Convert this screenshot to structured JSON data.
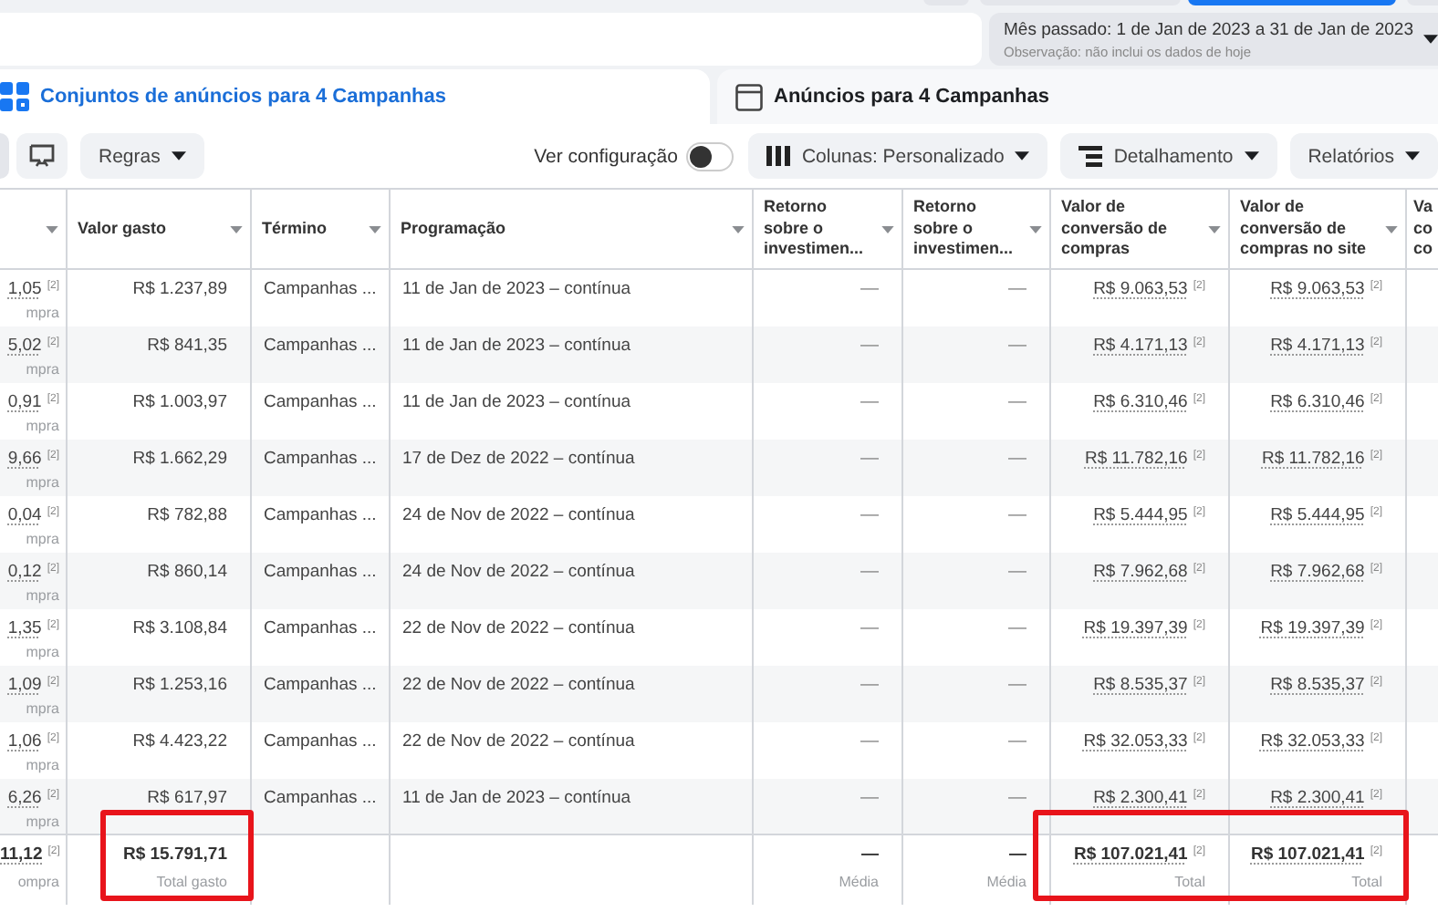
{
  "date_range": {
    "label": "Mês passado: 1 de Jan de 2023 a 31 de Jan de 2023",
    "note": "Observação: não inclui os dados de hoje"
  },
  "tabs": [
    {
      "label": "Conjuntos de anúncios para 4 Campanhas",
      "kind": "adsets",
      "selected": true
    },
    {
      "label": "Anúncios para 4 Campanhas",
      "kind": "ads",
      "selected": false
    }
  ],
  "toolbar": {
    "rules": "Regras",
    "toggle": {
      "label": "Ver configuração",
      "on": false
    },
    "columns": "Colunas: Personalizado",
    "breakdown": "Detalhamento",
    "reports": "Relatórios"
  },
  "table": {
    "columns": [
      {
        "kind": "cut"
      },
      {
        "label": "Valor gasto"
      },
      {
        "label": "Término"
      },
      {
        "label": "Programação"
      },
      {
        "label": "Retorno sobre o investimen..."
      },
      {
        "label": "Retorno sobre o investimen..."
      },
      {
        "label": "Valor de conversão de compras"
      },
      {
        "label": "Valor de conversão de compras no site"
      },
      {
        "label": "Va co co"
      }
    ],
    "rows": [
      {
        "cells": [
          {
            "kind": "metric",
            "value": "1,05",
            "note": "[2]",
            "sub": "mpra"
          },
          {
            "kind": "plain",
            "value": "R$ 1.237,89"
          },
          {
            "kind": "plain",
            "value": "Campanhas ..."
          },
          {
            "kind": "plain",
            "value": "11 de Jan de 2023 – contínua"
          },
          {
            "kind": "dash",
            "value": "—"
          },
          {
            "kind": "dash",
            "value": "—"
          },
          {
            "kind": "metric",
            "value": "R$ 9.063,53",
            "note": "[2]"
          },
          {
            "kind": "metric",
            "value": "R$ 9.063,53",
            "note": "[2]"
          }
        ]
      },
      {
        "cells": [
          {
            "kind": "metric",
            "value": "5,02",
            "note": "[2]",
            "sub": "mpra"
          },
          {
            "kind": "plain",
            "value": "R$ 841,35"
          },
          {
            "kind": "plain",
            "value": "Campanhas ..."
          },
          {
            "kind": "plain",
            "value": "11 de Jan de 2023 – contínua"
          },
          {
            "kind": "dash",
            "value": "—"
          },
          {
            "kind": "dash",
            "value": "—"
          },
          {
            "kind": "metric",
            "value": "R$ 4.171,13",
            "note": "[2]"
          },
          {
            "kind": "metric",
            "value": "R$ 4.171,13",
            "note": "[2]"
          }
        ]
      },
      {
        "cells": [
          {
            "kind": "metric",
            "value": "0,91",
            "note": "[2]",
            "sub": "mpra"
          },
          {
            "kind": "plain",
            "value": "R$ 1.003,97"
          },
          {
            "kind": "plain",
            "value": "Campanhas ..."
          },
          {
            "kind": "plain",
            "value": "11 de Jan de 2023 – contínua"
          },
          {
            "kind": "dash",
            "value": "—"
          },
          {
            "kind": "dash",
            "value": "—"
          },
          {
            "kind": "metric",
            "value": "R$ 6.310,46",
            "note": "[2]"
          },
          {
            "kind": "metric",
            "value": "R$ 6.310,46",
            "note": "[2]"
          }
        ]
      },
      {
        "cells": [
          {
            "kind": "metric",
            "value": "9,66",
            "note": "[2]",
            "sub": "mpra"
          },
          {
            "kind": "plain",
            "value": "R$ 1.662,29"
          },
          {
            "kind": "plain",
            "value": "Campanhas ..."
          },
          {
            "kind": "plain",
            "value": "17 de Dez de 2022 – contínua"
          },
          {
            "kind": "dash",
            "value": "—"
          },
          {
            "kind": "dash",
            "value": "—"
          },
          {
            "kind": "metric",
            "value": "R$ 11.782,16",
            "note": "[2]"
          },
          {
            "kind": "metric",
            "value": "R$ 11.782,16",
            "note": "[2]"
          }
        ]
      },
      {
        "cells": [
          {
            "kind": "metric",
            "value": "0,04",
            "note": "[2]",
            "sub": "mpra"
          },
          {
            "kind": "plain",
            "value": "R$ 782,88"
          },
          {
            "kind": "plain",
            "value": "Campanhas ..."
          },
          {
            "kind": "plain",
            "value": "24 de Nov de 2022 – contínua"
          },
          {
            "kind": "dash",
            "value": "—"
          },
          {
            "kind": "dash",
            "value": "—"
          },
          {
            "kind": "metric",
            "value": "R$ 5.444,95",
            "note": "[2]"
          },
          {
            "kind": "metric",
            "value": "R$ 5.444,95",
            "note": "[2]"
          }
        ]
      },
      {
        "cells": [
          {
            "kind": "metric",
            "value": "0,12",
            "note": "[2]",
            "sub": "mpra"
          },
          {
            "kind": "plain",
            "value": "R$ 860,14"
          },
          {
            "kind": "plain",
            "value": "Campanhas ..."
          },
          {
            "kind": "plain",
            "value": "24 de Nov de 2022 – contínua"
          },
          {
            "kind": "dash",
            "value": "—"
          },
          {
            "kind": "dash",
            "value": "—"
          },
          {
            "kind": "metric",
            "value": "R$ 7.962,68",
            "note": "[2]"
          },
          {
            "kind": "metric",
            "value": "R$ 7.962,68",
            "note": "[2]"
          }
        ]
      },
      {
        "cells": [
          {
            "kind": "metric",
            "value": "1,35",
            "note": "[2]",
            "sub": "mpra"
          },
          {
            "kind": "plain",
            "value": "R$ 3.108,84"
          },
          {
            "kind": "plain",
            "value": "Campanhas ..."
          },
          {
            "kind": "plain",
            "value": "22 de Nov de 2022 – contínua"
          },
          {
            "kind": "dash",
            "value": "—"
          },
          {
            "kind": "dash",
            "value": "—"
          },
          {
            "kind": "metric",
            "value": "R$ 19.397,39",
            "note": "[2]"
          },
          {
            "kind": "metric",
            "value": "R$ 19.397,39",
            "note": "[2]"
          }
        ]
      },
      {
        "cells": [
          {
            "kind": "metric",
            "value": "1,09",
            "note": "[2]",
            "sub": "mpra"
          },
          {
            "kind": "plain",
            "value": "R$ 1.253,16"
          },
          {
            "kind": "plain",
            "value": "Campanhas ..."
          },
          {
            "kind": "plain",
            "value": "22 de Nov de 2022 – contínua"
          },
          {
            "kind": "dash",
            "value": "—"
          },
          {
            "kind": "dash",
            "value": "—"
          },
          {
            "kind": "metric",
            "value": "R$ 8.535,37",
            "note": "[2]"
          },
          {
            "kind": "metric",
            "value": "R$ 8.535,37",
            "note": "[2]"
          }
        ]
      },
      {
        "cells": [
          {
            "kind": "metric",
            "value": "1,06",
            "note": "[2]",
            "sub": "mpra"
          },
          {
            "kind": "plain",
            "value": "R$ 4.423,22"
          },
          {
            "kind": "plain",
            "value": "Campanhas ..."
          },
          {
            "kind": "plain",
            "value": "22 de Nov de 2022 – contínua"
          },
          {
            "kind": "dash",
            "value": "—"
          },
          {
            "kind": "dash",
            "value": "—"
          },
          {
            "kind": "metric",
            "value": "R$ 32.053,33",
            "note": "[2]"
          },
          {
            "kind": "metric",
            "value": "R$ 32.053,33",
            "note": "[2]"
          }
        ]
      },
      {
        "cells": [
          {
            "kind": "metric",
            "value": "6,26",
            "note": "[2]",
            "sub": "mpra"
          },
          {
            "kind": "plain",
            "value": "R$ 617,97"
          },
          {
            "kind": "plain",
            "value": "Campanhas ..."
          },
          {
            "kind": "plain",
            "value": "11 de Jan de 2023 – contínua"
          },
          {
            "kind": "dash",
            "value": "—"
          },
          {
            "kind": "dash",
            "value": "—"
          },
          {
            "kind": "metric",
            "value": "R$ 2.300,41",
            "note": "[2]"
          },
          {
            "kind": "metric",
            "value": "R$ 2.300,41",
            "note": "[2]"
          }
        ]
      }
    ],
    "totals": [
      {
        "kind": "metric",
        "value": "11,12",
        "note": "[2]",
        "sub": "ompra",
        "highlighted": false
      },
      {
        "kind": "plain",
        "value": "R$ 15.791,71",
        "sub": "Total gasto",
        "highlighted": true
      },
      {
        "kind": "empty",
        "highlighted": false
      },
      {
        "kind": "empty",
        "highlighted": false
      },
      {
        "kind": "dash",
        "value": "—",
        "sub": "Média",
        "highlighted": false
      },
      {
        "kind": "dash",
        "value": "—",
        "sub": "Média",
        "highlighted": false
      },
      {
        "kind": "metric",
        "value": "R$ 107.021,41",
        "note": "[2]",
        "sub": "Total",
        "highlighted": true
      },
      {
        "kind": "metric",
        "value": "R$ 107.021,41",
        "note": "[2]",
        "sub": "Total",
        "highlighted": true
      }
    ]
  }
}
